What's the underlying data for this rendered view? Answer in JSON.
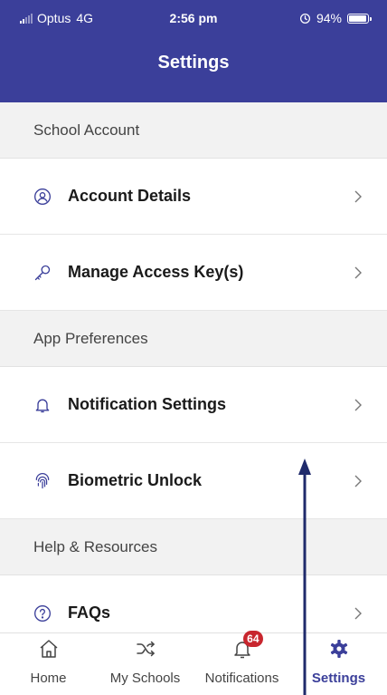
{
  "status_bar": {
    "carrier": "Optus",
    "network": "4G",
    "time": "2:56 pm",
    "battery_label": "94%",
    "battery_level": 0.94,
    "signal_bars_active": 2,
    "signal_bars_total": 5
  },
  "header": {
    "title": "Settings",
    "background": "#3b3f9a"
  },
  "sections": [
    {
      "title": "School Account",
      "items": [
        {
          "label": "Account Details",
          "icon": "account-circle-icon"
        },
        {
          "label": "Manage Access Key(s)",
          "icon": "key-icon"
        }
      ]
    },
    {
      "title": "App Preferences",
      "items": [
        {
          "label": "Notification Settings",
          "icon": "bell-icon"
        },
        {
          "label": "Biometric Unlock",
          "icon": "fingerprint-icon"
        }
      ]
    },
    {
      "title": "Help & Resources",
      "items": [
        {
          "label": "FAQs",
          "icon": "question-circle-icon"
        }
      ]
    }
  ],
  "tabs": [
    {
      "label": "Home",
      "icon": "home-icon",
      "active": false
    },
    {
      "label": "My Schools",
      "icon": "shuffle-icon",
      "active": false
    },
    {
      "label": "Notifications",
      "icon": "bell-icon",
      "badge": "64",
      "active": false
    },
    {
      "label": "Settings",
      "icon": "gear-icon",
      "active": true
    }
  ],
  "colors": {
    "accent": "#3b3f9a",
    "badge": "#c8262e",
    "section_bg": "#f2f2f2"
  }
}
